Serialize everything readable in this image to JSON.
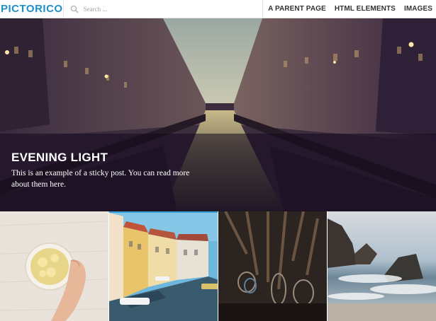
{
  "site": {
    "title": "PICTORICO"
  },
  "search": {
    "placeholder": "Search ..."
  },
  "nav": {
    "items": [
      "A PARENT PAGE",
      "HTML ELEMENTS",
      "IMAGES"
    ]
  },
  "hero": {
    "title": "EVENING LIGHT",
    "excerpt": "This is an example of a sticky post. You can read more about them here."
  },
  "colors": {
    "brand": "#1e90c8",
    "active_border": "#3aa0d8"
  },
  "icons": {
    "search": "search-icon"
  },
  "thumbnails": [
    {
      "subject": "lemon tea"
    },
    {
      "subject": "canal village"
    },
    {
      "subject": "tools in shed"
    },
    {
      "subject": "rocky shore"
    }
  ]
}
